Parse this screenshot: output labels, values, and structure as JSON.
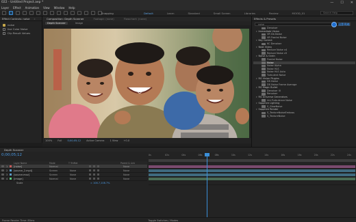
{
  "window": {
    "title": "022 - Untitled Project.aep *",
    "controls": [
      "—",
      "☐",
      "✕"
    ]
  },
  "menu": [
    "Layer",
    "Effect",
    "Animation",
    "View",
    "Window",
    "Help"
  ],
  "toolbar": {
    "snapping_label": "Snapping",
    "workspaces": [
      "Default",
      "Learn",
      "Standard",
      "Small Screen",
      "Libraries",
      "Review",
      "MOOD_01"
    ],
    "current_workspace": "Default",
    "search_placeholder": "Search Help"
  },
  "effect_controls": {
    "tab_label": "Effect Controls: noise",
    "tab_alt": "»",
    "layer_label": "noise",
    "effects": [
      "Use Color Noise",
      "Clip Result Values"
    ]
  },
  "composition": {
    "tabs": [
      "Composition: Depth Scanner",
      "Footage: (none)",
      "Flowchart: (none)"
    ],
    "current_tab": "Composition: Depth Scanner",
    "subtabs": [
      "Depth Scanner",
      "Image"
    ],
    "current_subtab": "Depth Scanner",
    "footer": {
      "zoom": "100%",
      "resolution": "Full",
      "timecode": "0;00;05;12",
      "view": "Active Camera",
      "views": "1 View",
      "offset": "+0.0"
    }
  },
  "effects_presets": {
    "title": "Effects & Presets",
    "search_value": "noise",
    "items": [
      {
        "kind": "eff",
        "label": "Denoiser"
      },
      {
        "kind": "cat",
        "label": "Immediate Vision"
      },
      {
        "kind": "eff",
        "label": "VR De-Noise"
      },
      {
        "kind": "eff",
        "label": "VR Fractal Noise"
      },
      {
        "kind": "cat",
        "label": "Key Correct"
      },
      {
        "kind": "eff",
        "label": "KC Denoiser"
      },
      {
        "kind": "cat",
        "label": "Neat Video"
      },
      {
        "kind": "eff",
        "label": "Reduce Noise v4"
      },
      {
        "kind": "eff",
        "label": "Reduce Noise v5"
      },
      {
        "kind": "cat",
        "label": "Noise & Grain"
      },
      {
        "kind": "eff",
        "label": "Fractal Noise"
      },
      {
        "kind": "eff",
        "label": "Noise",
        "selected": true
      },
      {
        "kind": "eff",
        "label": "Noise Alpha"
      },
      {
        "kind": "eff",
        "label": "Noise HLS"
      },
      {
        "kind": "eff",
        "label": "Noise HLS Auto"
      },
      {
        "kind": "eff",
        "label": "Turbulent Noise"
      },
      {
        "kind": "cat",
        "label": "RG Vision Plugins"
      },
      {
        "kind": "eff",
        "label": "DE-Noise"
      },
      {
        "kind": "eff",
        "label": "DE-Noise Frame Average"
      },
      {
        "kind": "cat",
        "label": "RG Magic Bullet"
      },
      {
        "kind": "eff",
        "label": "Denoiser III"
      },
      {
        "kind": "eff",
        "label": "Renoiser"
      },
      {
        "kind": "cat",
        "label": "RG Universe Generators"
      },
      {
        "kind": "eff",
        "label": "Uni.Turbulence Noise"
      },
      {
        "kind": "cat",
        "label": "Sapphire Lighting"
      },
      {
        "kind": "eff",
        "label": "S_GlowNoise"
      },
      {
        "kind": "cat",
        "label": "Sapphire Render"
      },
      {
        "kind": "eff",
        "label": "S_TextureNoiseEmboss"
      },
      {
        "kind": "eff",
        "label": "S_TextureNoise"
      }
    ],
    "watermark_text": "迅影网络"
  },
  "timeline": {
    "tab_label": "Depth Scanner",
    "timecode": "0;00;05;12",
    "headers": [
      "Layer Name",
      "Mode",
      "T TrkMat",
      "Parent & Link"
    ],
    "layers": [
      {
        "num": "1",
        "name": "[noise]",
        "mode": "Normal",
        "trk": "",
        "parent": "None",
        "color": "#c85a5a",
        "bar": "#7a4a6e",
        "selected": true
      },
      {
        "num": "2",
        "name": "[source_2.mp4]",
        "mode": "Screen",
        "trk": "None",
        "parent": "None",
        "color": "#5a9ac8",
        "bar": "#3f6a7f"
      },
      {
        "num": "3",
        "name": "[source.mov]",
        "mode": "Screen",
        "trk": "None",
        "parent": "None",
        "color": "#5a9ac8",
        "bar": "#3f6a7f"
      },
      {
        "num": "4",
        "name": "[image]",
        "mode": "Normal",
        "trk": "None",
        "parent": "None",
        "color": "#5ac87a",
        "bar": "#4a6b55"
      }
    ],
    "property": {
      "name": "Scale",
      "value": "∞ 108.7,108.7%"
    },
    "ruler_ticks": [
      "0s",
      "02s",
      "04s",
      "06s",
      "08s",
      "10s",
      "12s",
      "14s",
      "16s",
      "18s",
      "20s",
      "22s",
      "24s"
    ],
    "footer_left": "Frame Render Time: 85ms",
    "footer_right": "Toggle Switches / Modes"
  },
  "colors": {
    "accent": "#3b8fd9",
    "panel": "#232323",
    "selected_effect": "#3e3e3e"
  }
}
